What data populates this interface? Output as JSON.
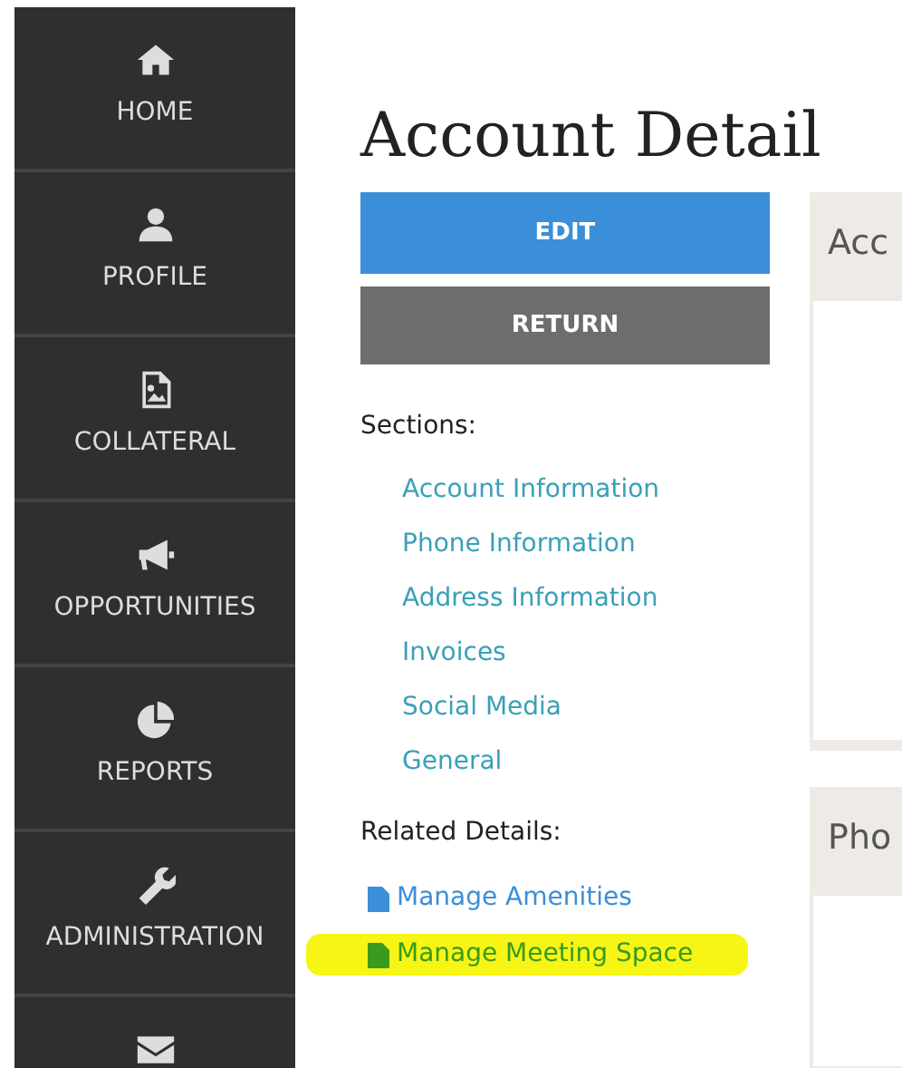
{
  "sidebar": {
    "items": [
      {
        "kind": "labeled",
        "label": "HOME"
      },
      {
        "kind": "labeled",
        "label": "PROFILE"
      },
      {
        "kind": "labeled",
        "label": "COLLATERAL"
      },
      {
        "kind": "labeled",
        "label": "OPPORTUNITIES"
      },
      {
        "kind": "labeled",
        "label": "REPORTS"
      },
      {
        "kind": "labeled",
        "label": "ADMINISTRATION"
      },
      {
        "kind": "icon-only"
      }
    ]
  },
  "title": "Account Detail",
  "buttons": [
    {
      "kind": "primary",
      "label": "EDIT"
    },
    {
      "kind": "secondary",
      "label": "RETURN"
    }
  ],
  "sections": {
    "heading": "Sections:",
    "links": [
      "Account Information",
      "Phone Information",
      "Address Information",
      "Invoices",
      "Social Media",
      "General"
    ]
  },
  "related": {
    "heading": "Related Details:",
    "links": [
      {
        "label": "Manage Amenities",
        "highlighted": false
      },
      {
        "label": "Manage Meeting Space",
        "highlighted": true
      }
    ]
  },
  "panels": [
    {
      "title": "Acc"
    },
    {
      "title": "Pho"
    }
  ]
}
